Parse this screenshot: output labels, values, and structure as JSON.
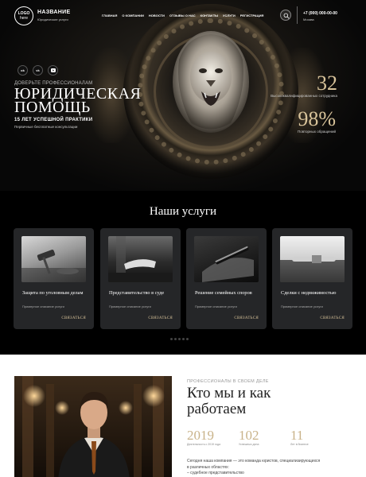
{
  "header": {
    "logo_line1": "LOGO",
    "logo_line2": "here",
    "brand": "НАЗВАНИЕ",
    "brand_sub": "Юридические услуги",
    "nav": [
      "ГЛАВНАЯ",
      "О КОМПАНИИ",
      "НОВОСТИ",
      "ОТЗЫВЫ О НАС",
      "КОНТАКТЫ",
      "УСЛУГИ",
      "РЕГИСТРАЦИЯ"
    ],
    "phone": "+7 (000) 000-00-00",
    "city": "Москва"
  },
  "socials": [
    "ok-icon",
    "vk-icon",
    "youtube-icon"
  ],
  "hero": {
    "eyebrow": "ДОВЕРЬТЕ ПРОФЕССИОНАЛАМ",
    "title_line1": "ЮРИДИЧЕСКАЯ",
    "title_line2": "ПОМОЩЬ",
    "subtitle": "15 ЛЕТ УСПЕШНОЙ ПРАКТИКИ",
    "note": "Первичные бесплатные консультации",
    "stat1_num": "32",
    "stat1_label": "Высококвалифицированных сотрудника",
    "stat2_num": "98%",
    "stat2_label": "Повторных обращений"
  },
  "services": {
    "title": "Наши услуги",
    "items": [
      {
        "title": "Защита по уголовным делам",
        "desc": "Примерное описание услуги",
        "link": "СВЯЗАТЬСЯ"
      },
      {
        "title": "Представительство в суде",
        "desc": "Примерное описание услуги",
        "link": "СВЯЗАТЬСЯ"
      },
      {
        "title": "Решение семейных споров",
        "desc": "Примерное описание услуги",
        "link": "СВЯЗАТЬСЯ"
      },
      {
        "title": "Сделки с недвижимостью",
        "desc": "Примерное описание услуги",
        "link": "СВЯЗАТЬСЯ"
      }
    ]
  },
  "about": {
    "eyebrow": "ПРОФЕССИОНАЛЫ В СВОЕМ ДЕЛЕ",
    "title_line1": "Кто мы и как",
    "title_line2": "работаем",
    "stats": [
      {
        "num": "2019",
        "label": "Деятельность с 2019 года"
      },
      {
        "num": "102",
        "label": "Успешных дела"
      },
      {
        "num": "11",
        "label": "Лет в бизнесе"
      }
    ],
    "text_line1": "Сегодня наша компания — это команда юристов, специализирующихся",
    "text_line2": "в различных областях:",
    "text_line3": "– судебное представительство"
  },
  "colors": {
    "accent": "#d8c39a",
    "card_bg": "#252628",
    "page_bg": "#000000"
  }
}
